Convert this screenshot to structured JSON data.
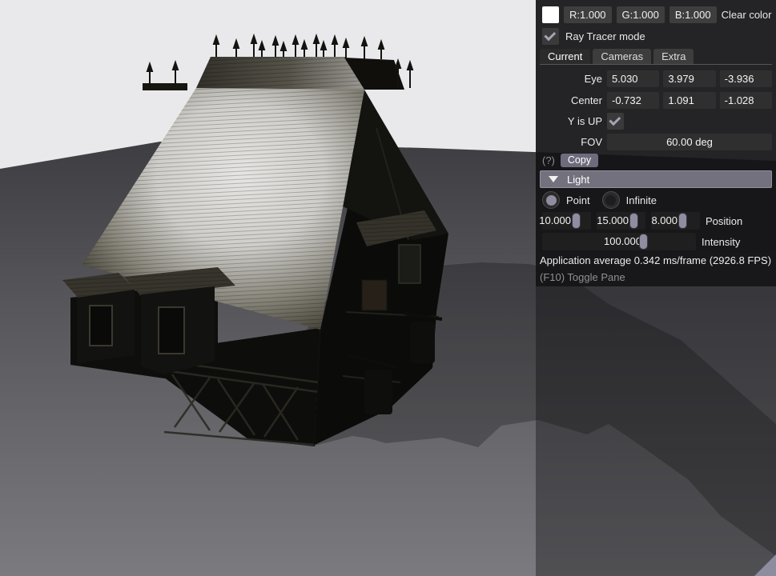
{
  "scene": {
    "name": "3d-viewport-medieval-house",
    "colors": {
      "sky": "#e9e9eb",
      "ground_near": "#7b7b7f",
      "ground_far": "#3f3f43",
      "roof_highlight": "#e4e3e1",
      "roof_dark": "#3a372e",
      "house_dark": "#0b0b09",
      "pane_overlay": "rgba(10,10,12,0.38)",
      "accent_lavender": "#8f8da0"
    }
  },
  "panel": {
    "color_row": {
      "swatch_color": "#ffffff",
      "r_label": "R:1.000",
      "g_label": "G:1.000",
      "b_label": "B:1.000",
      "clear_label": "Clear color"
    },
    "ray_tracer": {
      "label": "Ray Tracer mode",
      "checked": true
    },
    "tabs": [
      {
        "label": "Current",
        "active": true
      },
      {
        "label": "Cameras",
        "active": false
      },
      {
        "label": "Extra",
        "active": false
      }
    ],
    "camera": {
      "eye": {
        "label": "Eye",
        "values": [
          "5.030",
          "3.979",
          "-3.936"
        ]
      },
      "center": {
        "label": "Center",
        "values": [
          "-0.732",
          "1.091",
          "-1.028"
        ]
      },
      "y_up": {
        "label": "Y is UP",
        "checked": true
      },
      "fov": {
        "label": "FOV",
        "value": "60.00 deg"
      }
    },
    "help_label": "(?)",
    "copy_label": "Copy",
    "light": {
      "header": "Light",
      "point_label": "Point",
      "infinite_label": "Infinite",
      "selected_mode": "Point",
      "position": {
        "label": "Position",
        "values": [
          "10.000",
          "15.000",
          "8.000"
        ]
      },
      "intensity": {
        "label": "Intensity",
        "value": "100.000"
      }
    },
    "stats": "Application average 0.342 ms/frame (2926.8 FPS)",
    "toggle_hint": "(F10) Toggle Pane"
  }
}
